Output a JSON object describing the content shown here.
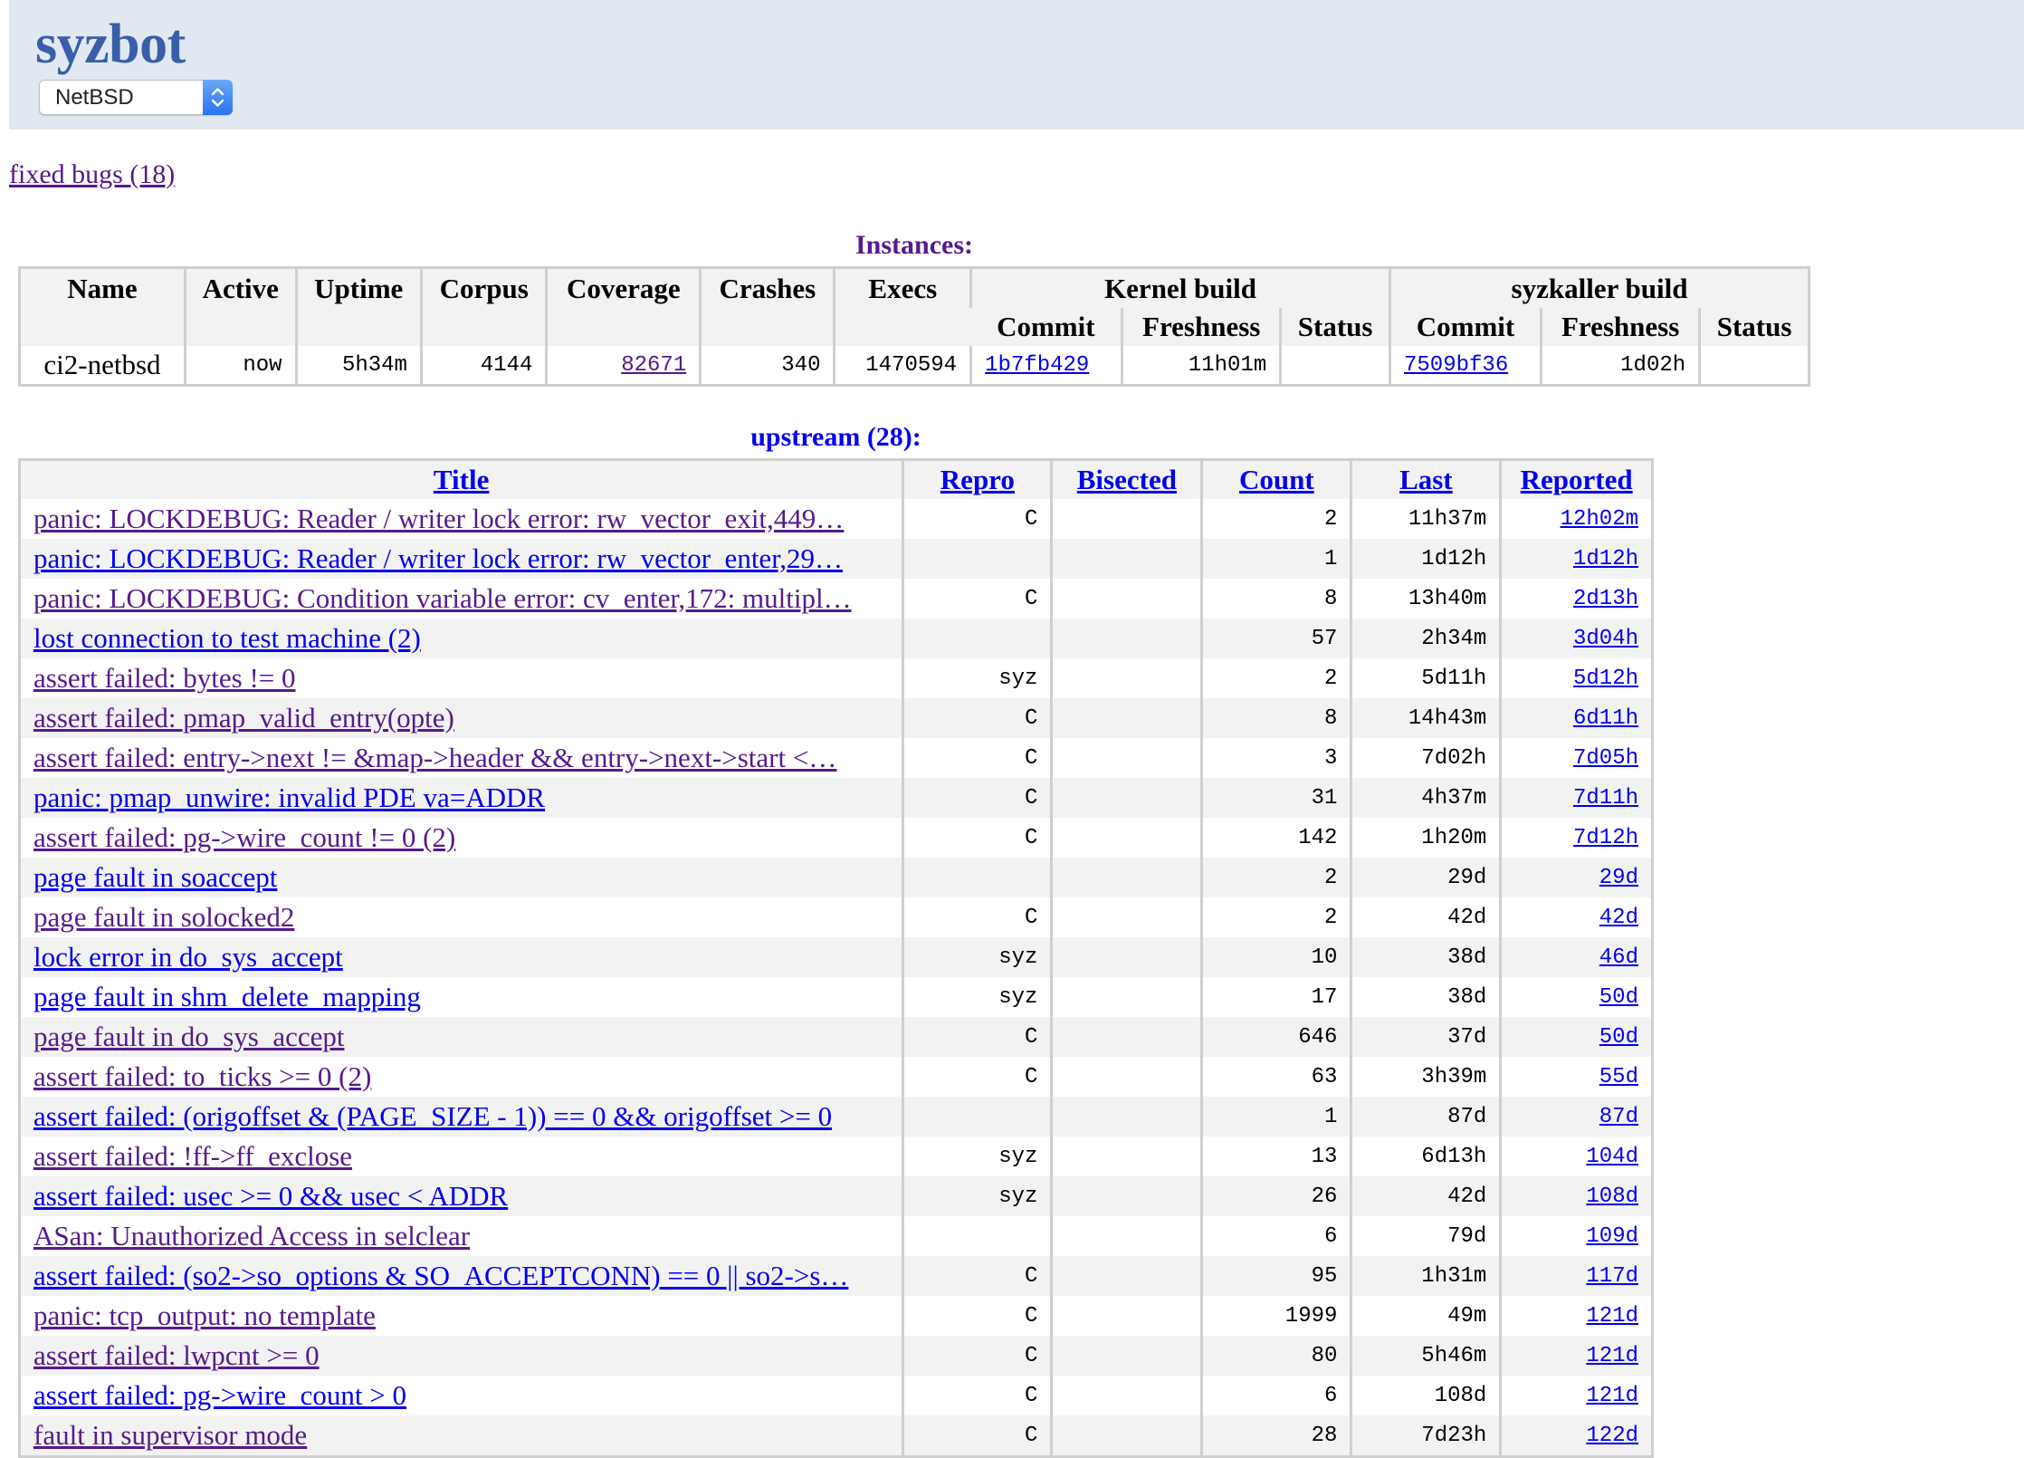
{
  "header": {
    "brand": "syzbot",
    "namespace_select": {
      "value": "NetBSD"
    }
  },
  "links": {
    "fixed_bugs": "fixed bugs (18)"
  },
  "colors": {
    "header_band": "#e1e8f2",
    "brand": "#3a5ea8",
    "link": "#0000ee",
    "visited_link": "#551a8b",
    "table_border": "#cfcfcf",
    "row_alt": "#f2f2f2"
  },
  "instances": {
    "caption": "Instances:",
    "headers": {
      "name": "Name",
      "active": "Active",
      "uptime": "Uptime",
      "corpus": "Corpus",
      "coverage": "Coverage",
      "crashes": "Crashes",
      "execs": "Execs",
      "kernel_build": "Kernel build",
      "syzkaller_build": "syzkaller build",
      "commit": "Commit",
      "freshness": "Freshness",
      "status": "Status"
    },
    "rows": [
      {
        "name": "ci2-netbsd",
        "active": "now",
        "uptime": "5h34m",
        "corpus": "4144",
        "coverage": "82671",
        "crashes": "340",
        "execs": "1470594",
        "kernel_commit": "1b7fb429",
        "kernel_freshness": "11h01m",
        "kernel_status": "",
        "syzkaller_commit": "7509bf36",
        "syzkaller_freshness": "1d02h",
        "syzkaller_status": ""
      }
    ]
  },
  "upstream": {
    "caption": "upstream (28):",
    "headers": {
      "title": "Title",
      "repro": "Repro",
      "bisected": "Bisected",
      "count": "Count",
      "last": "Last",
      "reported": "Reported"
    },
    "rows": [
      {
        "title": "panic: LOCKDEBUG: Reader / writer lock error: rw_vector_exit,449…",
        "visited": true,
        "repro": "C",
        "bisected": "",
        "count": "2",
        "last": "11h37m",
        "reported": "12h02m"
      },
      {
        "title": "panic: LOCKDEBUG: Reader / writer lock error: rw_vector_enter,29…",
        "visited": false,
        "repro": "",
        "bisected": "",
        "count": "1",
        "last": "1d12h",
        "reported": "1d12h"
      },
      {
        "title": "panic: LOCKDEBUG: Condition variable error: cv_enter,172: multipl…",
        "visited": true,
        "repro": "C",
        "bisected": "",
        "count": "8",
        "last": "13h40m",
        "reported": "2d13h"
      },
      {
        "title": "lost connection to test machine (2)",
        "visited": false,
        "repro": "",
        "bisected": "",
        "count": "57",
        "last": "2h34m",
        "reported": "3d04h"
      },
      {
        "title": "assert failed: bytes != 0",
        "visited": true,
        "repro": "syz",
        "bisected": "",
        "count": "2",
        "last": "5d11h",
        "reported": "5d12h"
      },
      {
        "title": "assert failed: pmap_valid_entry(opte)",
        "visited": true,
        "repro": "C",
        "bisected": "",
        "count": "8",
        "last": "14h43m",
        "reported": "6d11h"
      },
      {
        "title": "assert failed: entry->next != &map->header && entry->next->start <…",
        "visited": true,
        "repro": "C",
        "bisected": "",
        "count": "3",
        "last": "7d02h",
        "reported": "7d05h"
      },
      {
        "title": "panic: pmap_unwire: invalid PDE va=ADDR",
        "visited": false,
        "repro": "C",
        "bisected": "",
        "count": "31",
        "last": "4h37m",
        "reported": "7d11h"
      },
      {
        "title": "assert failed: pg->wire_count != 0 (2)",
        "visited": true,
        "repro": "C",
        "bisected": "",
        "count": "142",
        "last": "1h20m",
        "reported": "7d12h"
      },
      {
        "title": "page fault in soaccept",
        "visited": false,
        "repro": "",
        "bisected": "",
        "count": "2",
        "last": "29d",
        "reported": "29d"
      },
      {
        "title": "page fault in solocked2",
        "visited": true,
        "repro": "C",
        "bisected": "",
        "count": "2",
        "last": "42d",
        "reported": "42d"
      },
      {
        "title": "lock error in do_sys_accept",
        "visited": false,
        "repro": "syz",
        "bisected": "",
        "count": "10",
        "last": "38d",
        "reported": "46d"
      },
      {
        "title": "page fault in shm_delete_mapping",
        "visited": false,
        "repro": "syz",
        "bisected": "",
        "count": "17",
        "last": "38d",
        "reported": "50d"
      },
      {
        "title": "page fault in do_sys_accept",
        "visited": true,
        "repro": "C",
        "bisected": "",
        "count": "646",
        "last": "37d",
        "reported": "50d"
      },
      {
        "title": "assert failed: to_ticks >= 0 (2)",
        "visited": true,
        "repro": "C",
        "bisected": "",
        "count": "63",
        "last": "3h39m",
        "reported": "55d"
      },
      {
        "title": "assert failed: (origoffset & (PAGE_SIZE - 1)) == 0 && origoffset >= 0",
        "visited": false,
        "repro": "",
        "bisected": "",
        "count": "1",
        "last": "87d",
        "reported": "87d"
      },
      {
        "title": "assert failed: !ff->ff_exclose",
        "visited": true,
        "repro": "syz",
        "bisected": "",
        "count": "13",
        "last": "6d13h",
        "reported": "104d"
      },
      {
        "title": "assert failed: usec >= 0 && usec < ADDR",
        "visited": false,
        "repro": "syz",
        "bisected": "",
        "count": "26",
        "last": "42d",
        "reported": "108d"
      },
      {
        "title": "ASan: Unauthorized Access in selclear",
        "visited": true,
        "repro": "",
        "bisected": "",
        "count": "6",
        "last": "79d",
        "reported": "109d"
      },
      {
        "title": "assert failed: (so2->so_options & SO_ACCEPTCONN) == 0 || so2->s…",
        "visited": false,
        "repro": "C",
        "bisected": "",
        "count": "95",
        "last": "1h31m",
        "reported": "117d"
      },
      {
        "title": "panic: tcp_output: no template",
        "visited": true,
        "repro": "C",
        "bisected": "",
        "count": "1999",
        "last": "49m",
        "reported": "121d"
      },
      {
        "title": "assert failed: lwpcnt >= 0",
        "visited": true,
        "repro": "C",
        "bisected": "",
        "count": "80",
        "last": "5h46m",
        "reported": "121d"
      },
      {
        "title": "assert failed: pg->wire_count > 0",
        "visited": false,
        "repro": "C",
        "bisected": "",
        "count": "6",
        "last": "108d",
        "reported": "121d"
      },
      {
        "title": "fault in supervisor mode",
        "visited": true,
        "repro": "C",
        "bisected": "",
        "count": "28",
        "last": "7d23h",
        "reported": "122d"
      }
    ]
  }
}
